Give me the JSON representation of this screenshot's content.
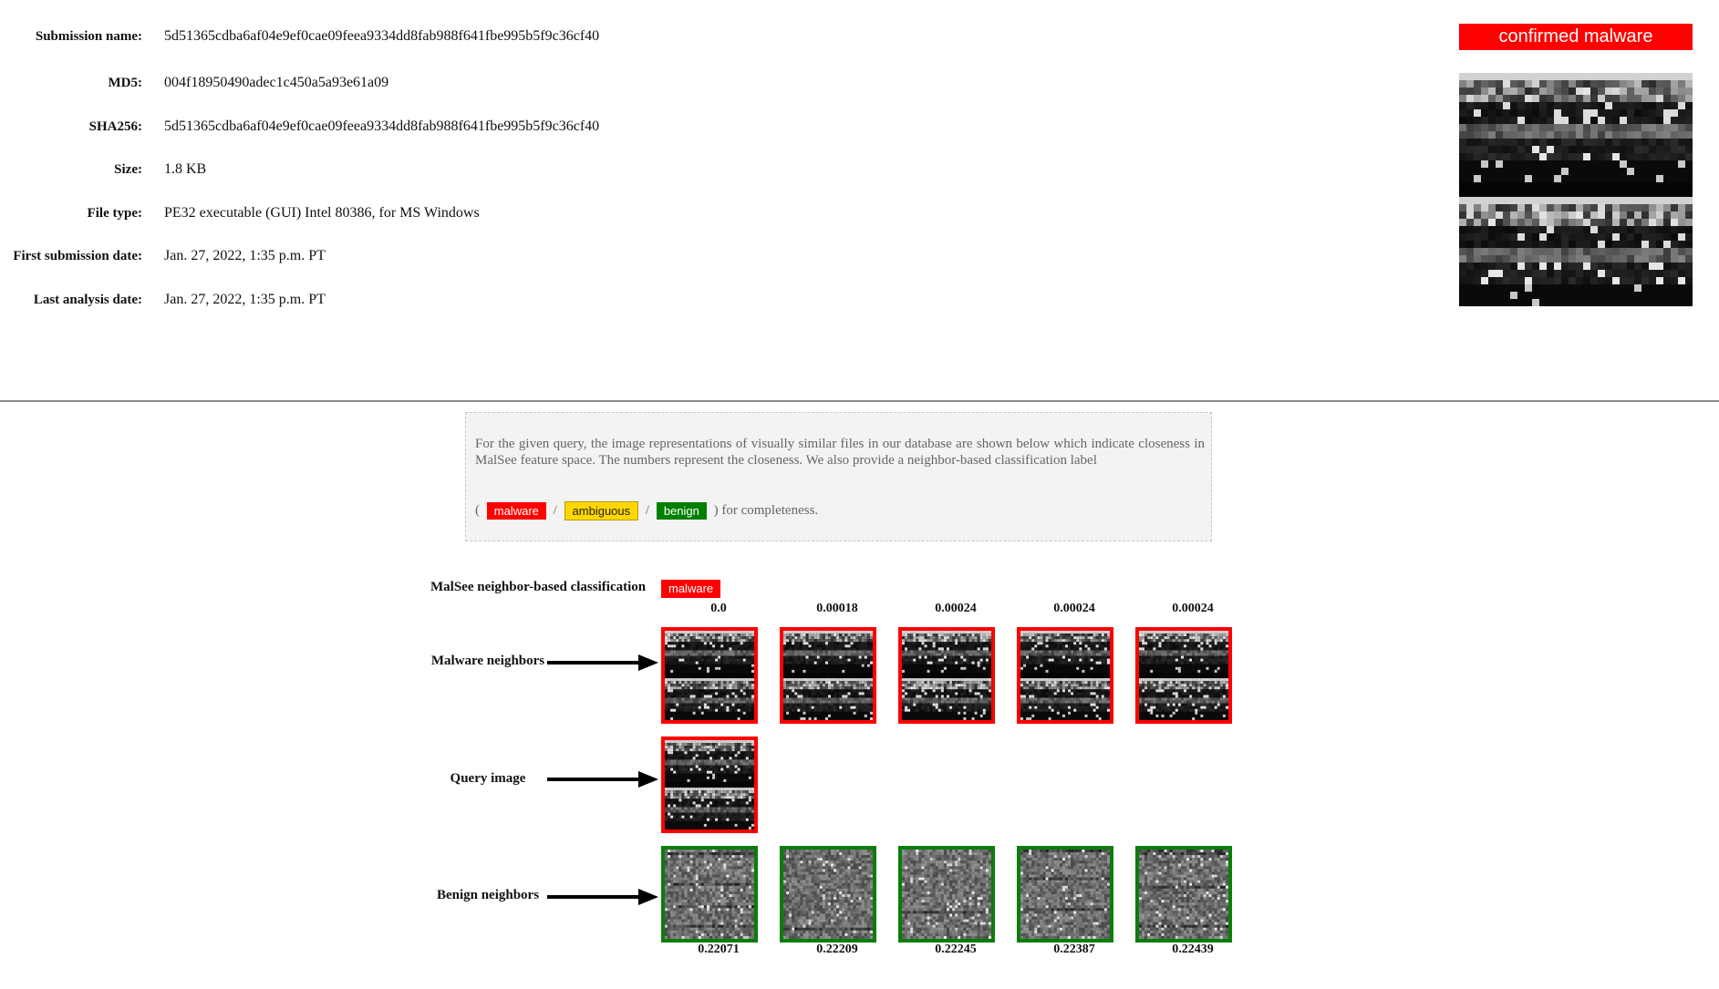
{
  "metadata": {
    "rows": [
      {
        "label": "Submission name:",
        "value": "5d51365cdba6af04e9ef0cae09feea9334dd8fab988f641fbe995b5f9c36cf40"
      },
      {
        "label": "MD5:",
        "value": "004f18950490adec1c450a5a93e61a09"
      },
      {
        "label": "SHA256:",
        "value": "5d51365cdba6af04e9ef0cae09feea9334dd8fab988f641fbe995b5f9c36cf40"
      },
      {
        "label": "Size:",
        "value": "1.8 KB"
      },
      {
        "label": "File type:",
        "value": "PE32 executable (GUI) Intel 80386, for MS Windows"
      },
      {
        "label": "First submission date:",
        "value": "Jan. 27, 2022, 1:35 p.m. PT"
      },
      {
        "label": "Last analysis date:",
        "value": "Jan. 27, 2022, 1:35 p.m. PT"
      }
    ]
  },
  "verdict": {
    "label": "confirmed malware",
    "color": "#ff0000"
  },
  "info": {
    "text": "For the given query, the image representations of visually similar files in our database are shown below which indicate closeness in MalSee feature space. The numbers represent the closeness. We also provide a neighbor-based classification label",
    "open_paren": "(",
    "sep": "/",
    "close_text": ") for completeness.",
    "tags": {
      "malware": "malware",
      "ambiguous": "ambiguous",
      "benign": "benign"
    }
  },
  "classification": {
    "label": "MalSee neighbor-based classification",
    "value": "malware"
  },
  "malware_neighbors": {
    "label": "Malware neighbors",
    "scores": [
      "0.0",
      "0.00018",
      "0.00024",
      "0.00024",
      "0.00024"
    ],
    "border_color": "#ff0000"
  },
  "query": {
    "label": "Query image",
    "border_color": "#ff0000"
  },
  "benign_neighbors": {
    "label": "Benign neighbors",
    "scores": [
      "0.22071",
      "0.22209",
      "0.22245",
      "0.22387",
      "0.22439"
    ],
    "border_color": "#0a7d0a"
  },
  "colors": {
    "malware": "#ff0000",
    "ambiguous": "#ffd700",
    "benign": "#008000"
  }
}
